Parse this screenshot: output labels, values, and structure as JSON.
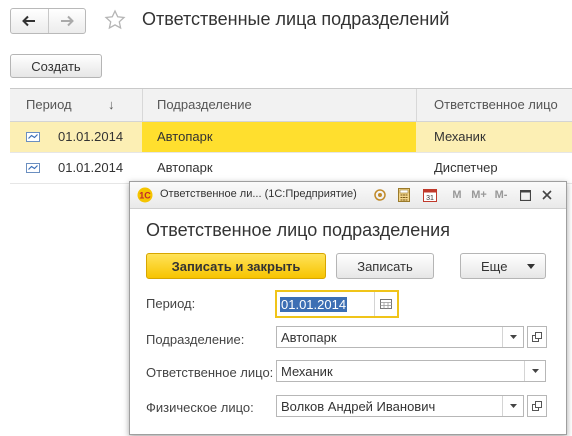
{
  "header": {
    "title": "Ответственные лица подразделений",
    "back_icon": "arrow-left-icon",
    "forward_icon": "arrow-right-icon",
    "favorite_icon": "star-icon"
  },
  "toolbar": {
    "create_label": "Создать"
  },
  "table": {
    "columns": [
      "Период",
      "Подразделение",
      "Ответственное лицо"
    ],
    "sort_indicator": "↓",
    "rows": [
      {
        "period": "01.01.2014",
        "department": "Автопарк",
        "person": "Механик",
        "selected": true
      },
      {
        "period": "01.01.2014",
        "department": "Автопарк",
        "person": "Диспетчер",
        "selected": false
      }
    ]
  },
  "dialog": {
    "window_title": "Ответственное ли... (1С:Предприятие)",
    "heading": "Ответственное лицо подразделения",
    "buttons": {
      "save_close": "Записать и закрыть",
      "save": "Записать",
      "more": "Еще"
    },
    "title_buttons": {
      "m": "M",
      "m_plus": "M+",
      "m_minus": "M-"
    },
    "fields": {
      "period": {
        "label": "Период:",
        "value": "01.01.2014"
      },
      "department": {
        "label": "Подразделение:",
        "value": "Автопарк"
      },
      "responsible": {
        "label": "Ответственное лицо:",
        "value": "Механик"
      },
      "individual": {
        "label": "Физическое лицо:",
        "value": "Волков Андрей Иванович"
      }
    }
  },
  "colors": {
    "accent_yellow": "#ffdf2e",
    "selected_row": "#fcefb4",
    "primary_button": "#f7c400",
    "focus_border": "#f0c419",
    "selection_text_bg": "#3d6fb4"
  }
}
